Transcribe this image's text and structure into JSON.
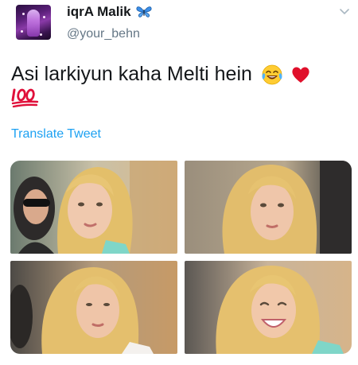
{
  "user": {
    "display_name": "iqrA Malik",
    "handle": "@your_behn",
    "verified_emoji": "butterfly-icon"
  },
  "tweet": {
    "text": "Asi larkiyun kaha Melti hein",
    "emojis": [
      "tears-of-joy-emoji",
      "red-heart-emoji",
      "hundred-points-emoji"
    ],
    "translate_label": "Translate Tweet"
  },
  "media": {
    "count": 4,
    "items": [
      "photo-1",
      "photo-2",
      "photo-3",
      "photo-4"
    ]
  },
  "colors": {
    "link": "#1da1f2",
    "text": "#14171a",
    "secondary": "#657786"
  }
}
